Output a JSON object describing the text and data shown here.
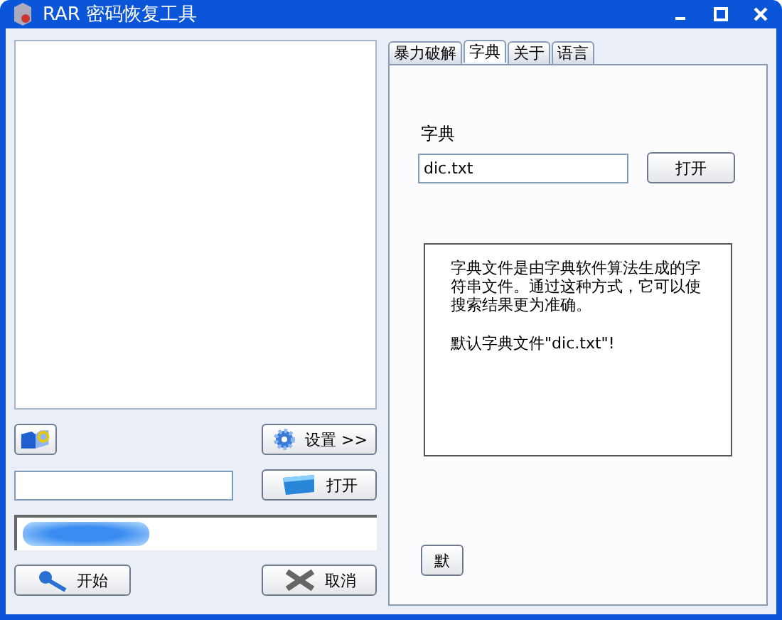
{
  "window": {
    "title": "RAR 密码恢复工具"
  },
  "left": {
    "settings_button": "设置 >>",
    "open_button": "打开",
    "progress": {
      "level": 0.35
    },
    "start_button": "开始",
    "cancel_button": "取消"
  },
  "tabs": [
    {
      "label": "暴力破解",
      "selected": false
    },
    {
      "label": "字典",
      "selected": true
    },
    {
      "label": "关于",
      "selected": false
    },
    {
      "label": "语言",
      "selected": false
    }
  ],
  "dictionary": {
    "label": "字典",
    "value": "dic.txt",
    "open_button": "打开",
    "info": [
      "字典文件是由字典软件算法生成的字符串文件。通过这种方式，它可以使搜索结果更为准确。",
      "默认字典文件\"dic.txt\"!"
    ],
    "default_button": "默"
  }
}
